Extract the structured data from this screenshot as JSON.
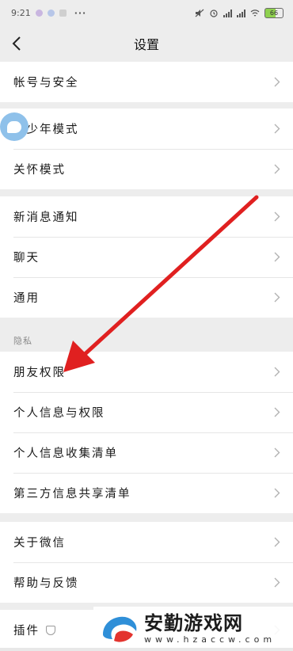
{
  "status_bar": {
    "time": "9:21",
    "battery": "66"
  },
  "nav": {
    "title": "设置"
  },
  "groups": [
    {
      "rows": [
        "帐号与安全"
      ]
    },
    {
      "rows": [
        "青少年模式",
        "关怀模式"
      ]
    },
    {
      "rows": [
        "新消息通知",
        "聊天",
        "通用"
      ]
    },
    {
      "rows": [
        "朋友权限",
        "个人信息与权限",
        "个人信息收集清单",
        "第三方信息共享清单"
      ]
    },
    {
      "rows": [
        "关于微信",
        "帮助与反馈"
      ]
    },
    {
      "rows": [
        "插件"
      ]
    }
  ],
  "section_privacy": "隐私",
  "watermark": {
    "title": "安勤游戏网",
    "url": "www.hzaccw.com"
  },
  "colors": {
    "annotation_arrow": "#e02020",
    "background": "#ededed"
  }
}
